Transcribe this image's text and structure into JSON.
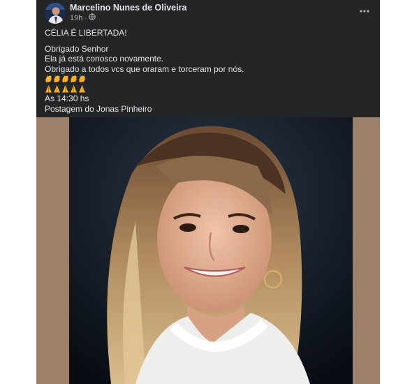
{
  "post": {
    "author": "Marcelino Nunes de Oliveira",
    "time": "19h",
    "separator": "·",
    "audience_icon": "globe-icon",
    "more_icon": "more-options-icon",
    "lines": {
      "title": "CÉLIA É LIBERTADA!",
      "l1": "Obrigado Senhor",
      "l2": "Ela já está conosco novamente.",
      "l3": "Obrigado a todos vcs que oraram e torceram por nós.",
      "time_line": "As 14:30 hs",
      "credit": " Postagem do Jonas Pinheiro"
    },
    "emoji_rows": [
      {
        "icon": "clapping-hands-emoji",
        "count": 5
      },
      {
        "icon": "praying-hands-emoji",
        "count": 5
      }
    ],
    "colors": {
      "card_bg": "#242526",
      "text": "#e4e6eb",
      "muted": "#b0b3b8",
      "photo_border": "#9c806a",
      "emoji": "#f5b321"
    }
  }
}
